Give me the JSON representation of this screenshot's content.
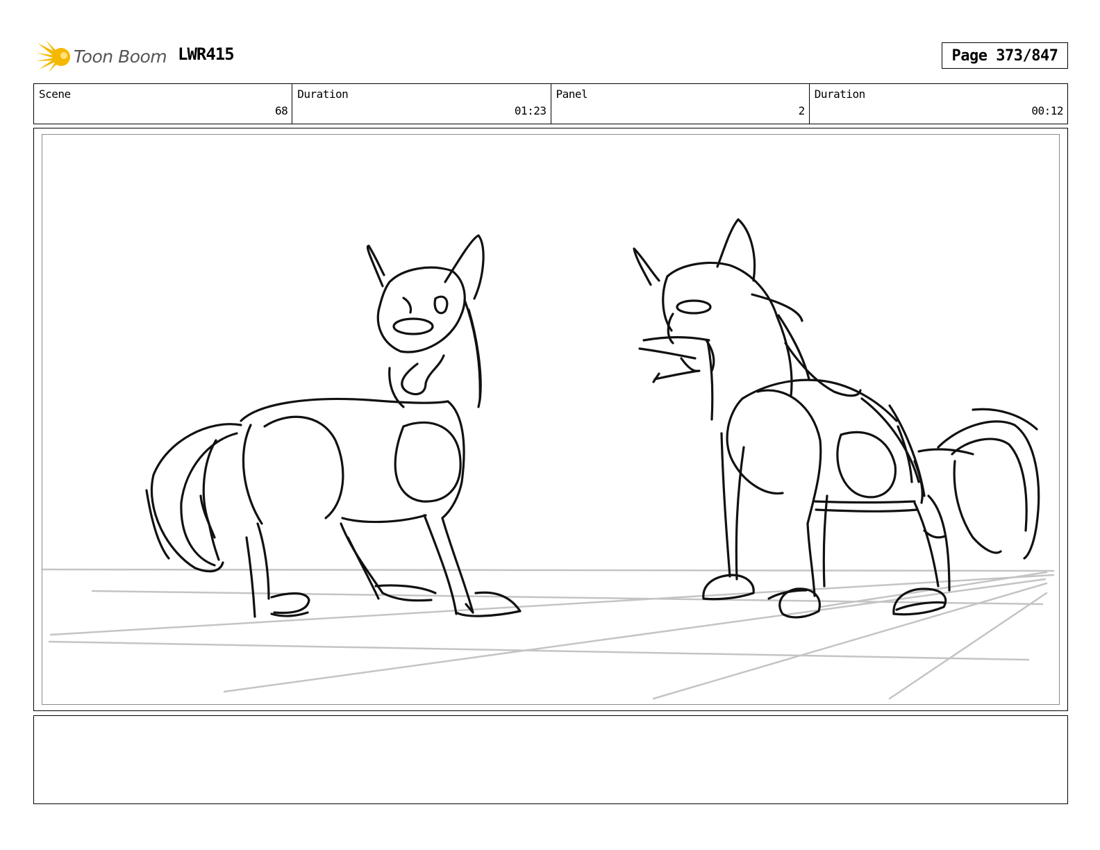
{
  "header": {
    "logo_text": "Toon Boom",
    "project_code": "LWR415",
    "page_label": "Page 373/847"
  },
  "info": [
    {
      "label": "Scene",
      "value": "68"
    },
    {
      "label": "Duration",
      "value": "01:23"
    },
    {
      "label": "Panel",
      "value": "2"
    },
    {
      "label": "Duration",
      "value": "00:12"
    }
  ],
  "panel": {
    "icon": "storyboard-sketch-two-wolves"
  },
  "caption": {
    "text": ""
  },
  "colors": {
    "logo_accent": "#f5b800",
    "logo_text": "#555555",
    "frame": "#000000",
    "ground_lines": "#c4c4c4"
  }
}
